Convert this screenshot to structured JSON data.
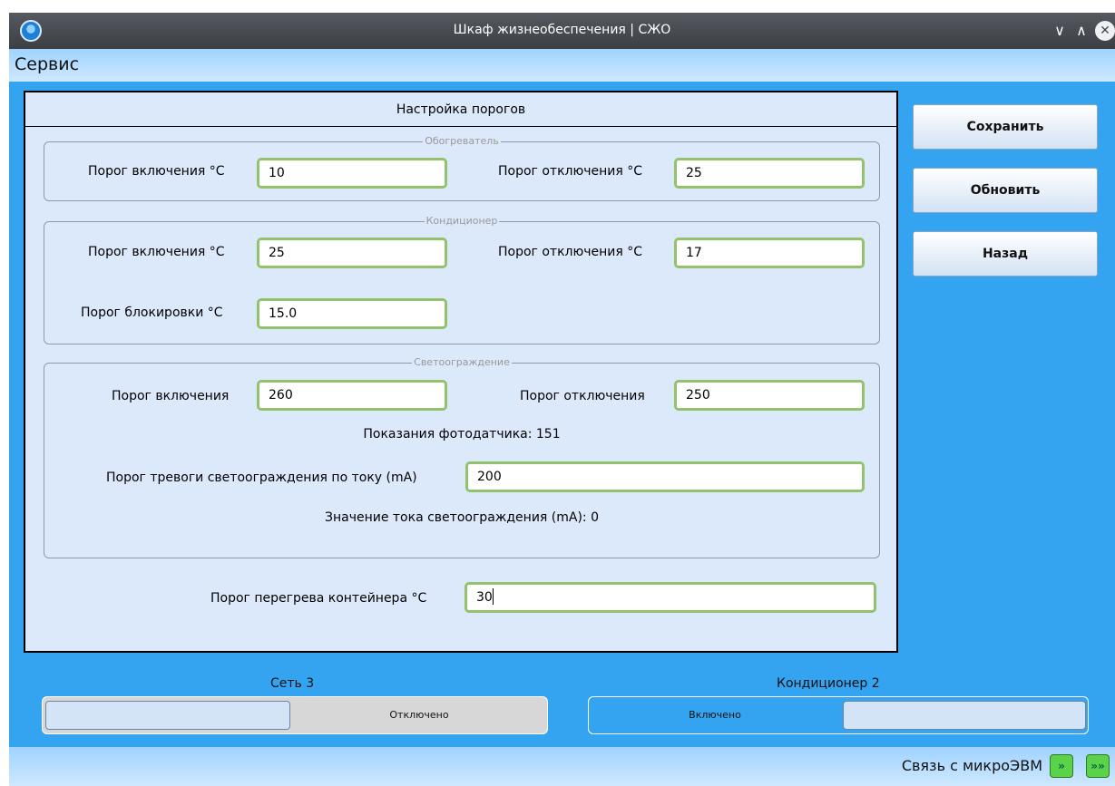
{
  "window": {
    "title": "Шкаф жизнеобеспечения | СЖО",
    "minimize_glyph": "∨",
    "maximize_glyph": "∧",
    "close_glyph": "✕"
  },
  "menu": {
    "title": "Сервис"
  },
  "panel": {
    "header": "Настройка порогов",
    "heater": {
      "legend": "Обогреватель",
      "on_label": "Порог включения °C",
      "on_value": "10",
      "off_label": "Порог отключения °C",
      "off_value": "25"
    },
    "aircon": {
      "legend": "Кондиционер",
      "on_label": "Порог включения °C",
      "on_value": "25",
      "off_label": "Порог отключения °C",
      "off_value": "17",
      "block_label": "Порог блокировки °C",
      "block_value": "15.0"
    },
    "lights": {
      "legend": "Светоограждение",
      "on_label": "Порог включения",
      "on_value": "260",
      "off_label": "Порог отключения",
      "off_value": "250",
      "photo_reading": "Показания фотодатчика: 151",
      "alarm_label": "Порог тревоги светоограждения по току (mA)",
      "alarm_value": "200",
      "current_value": "Значение тока светоограждения (mA): 0"
    },
    "overheat": {
      "label": "Порог перегрева контейнера °C",
      "value": "30"
    }
  },
  "buttons": {
    "save": "Сохранить",
    "refresh": "Обновить",
    "back": "Назад"
  },
  "toggles": {
    "net": {
      "caption": "Сеть 3",
      "state": "Отключено"
    },
    "aircon": {
      "caption": "Кондиционер 2",
      "state": "Включено"
    }
  },
  "status": {
    "link_label": "Связь с микроЭВМ",
    "icon1": "»",
    "icon2": "»»"
  },
  "colors": {
    "accent_blue": "#35a4f0",
    "field_border": "#92c26b",
    "status_green": "#5ad24a"
  }
}
